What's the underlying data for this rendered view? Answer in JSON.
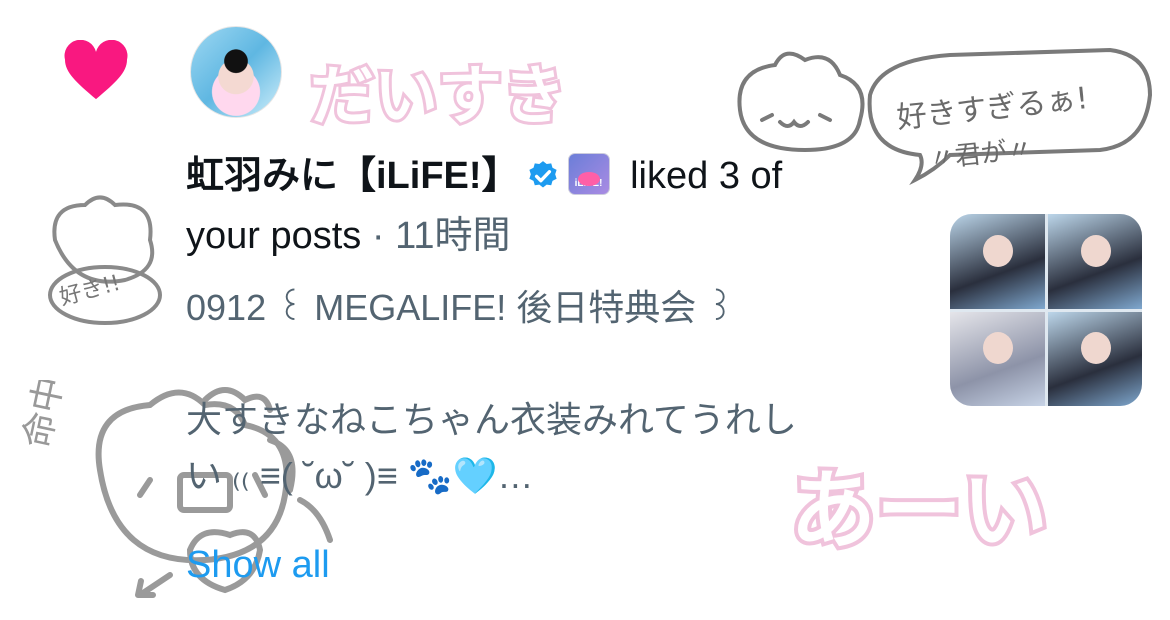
{
  "notification": {
    "user_name": "虹羽みに【iLiFE!】",
    "affiliate_badge": "iLiFE!",
    "action_text": " liked 3 of",
    "action_text_2": "your posts",
    "separator": " · ",
    "time": "11時間",
    "post_line1": "0912 ꒰ MEGALIFE! 後日特典会 ꒱",
    "post_line2": "",
    "post_line3": "大すきなねこちゃん衣装みれてうれし",
    "post_line4": "い ₍₍ ≡( ˘ω˘ )≡ 🐾🩵…",
    "show_all": "Show all"
  },
  "stickers": {
    "daisuki": "だいすき",
    "sukisugiru": "好きすぎるぁ!",
    "kimiga": "〃君が〃",
    "suki": "好き!!",
    "meichuu": "命中",
    "aai": "あーい"
  },
  "colors": {
    "heart": "#f91880",
    "verified": "#1d9bf0",
    "link": "#1d9bf0",
    "secondary_text": "#536471",
    "sticker_pink": "#f7c6e4"
  }
}
